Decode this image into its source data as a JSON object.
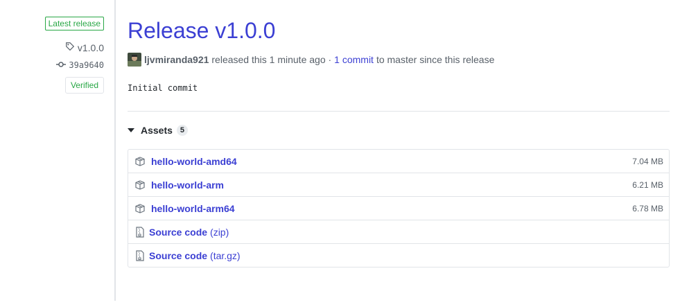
{
  "sidebar": {
    "latest_label": "Latest release",
    "tag": "v1.0.0",
    "commit": "39a9640",
    "verified_label": "Verified"
  },
  "release": {
    "title": "Release v1.0.0",
    "author": "ljvmiranda921",
    "released_text": "released this 1 minute ago ·",
    "commits_link": "1 commit",
    "commits_suffix": "to master since this release",
    "notes": "Initial commit"
  },
  "assets": {
    "label": "Assets",
    "count": "5",
    "items": [
      {
        "name": "hello-world-amd64",
        "size": "7.04 MB",
        "icon": "package-icon"
      },
      {
        "name": "hello-world-arm",
        "size": "6.21 MB",
        "icon": "package-icon"
      },
      {
        "name": "hello-world-arm64",
        "size": "6.78 MB",
        "icon": "package-icon"
      },
      {
        "name": "Source code",
        "ext": "(zip)",
        "icon": "file-zip-icon"
      },
      {
        "name": "Source code",
        "ext": "(tar.gz)",
        "icon": "file-zip-icon"
      }
    ]
  },
  "colors": {
    "link": "#3b3fd3",
    "success": "#28a745",
    "border": "#e1e4e8",
    "muted": "#586069"
  }
}
